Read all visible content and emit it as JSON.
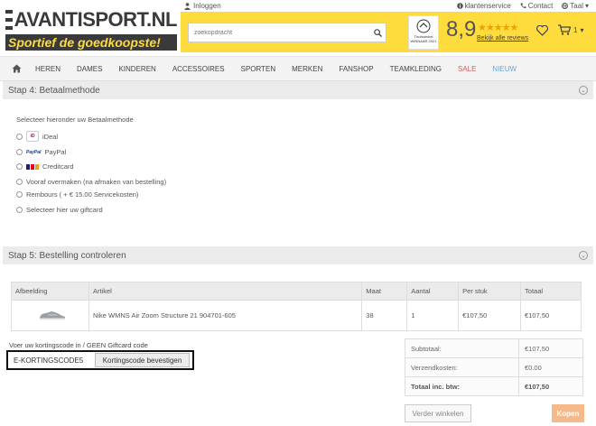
{
  "brand": {
    "name": "AVANTISPORT.NL",
    "tagline": "Sportief de goedkoopste!"
  },
  "topbar": {
    "login_label": "Inloggen",
    "customer_service": "klantenservice",
    "contact": "Contact",
    "language": "Taal"
  },
  "search": {
    "placeholder": "zoekopdracht"
  },
  "rating": {
    "badge_text": "Thuiswinkel WINNAAR 2021",
    "score": "8,9",
    "stars": "★★★★★",
    "reviews_link": "Bekijk alle reviews"
  },
  "cart": {
    "count": "1"
  },
  "nav": {
    "items": [
      "HEREN",
      "DAMES",
      "KINDEREN",
      "ACCESSOIRES",
      "SPORTEN",
      "MERKEN",
      "FANSHOP",
      "TEAMKLEDING",
      "SALE",
      "NIEUW"
    ]
  },
  "step4": {
    "title": "Stap 4: Betaalmethode",
    "intro": "Selecteer hieronder uw Betaalmethode",
    "options": [
      "iDeal",
      "PayPal",
      "Creditcard",
      "Vooraf overmaken (na afmaken van bestelling)",
      "Rembours ( + € 15.00 Servicekosten)",
      "Selecteer hier uw giftcard"
    ],
    "logo_ideal": "iD",
    "logo_paypal": "PayPal"
  },
  "step5": {
    "title": "Stap 5: Bestelling controleren",
    "headers": [
      "Afbeelding",
      "Artikel",
      "Maat",
      "Aantal",
      "Per stuk",
      "Totaal"
    ],
    "rows": [
      {
        "article": "Nike WMNS Air Zoom Structure 21 904701-605",
        "size": "38",
        "qty": "1",
        "unit": "€107,50",
        "total": "€107,50"
      }
    ]
  },
  "discount": {
    "label": "Voer uw kortingscode in / GEEN Giftcard code",
    "value": "E-KORTINGSCODE5",
    "button": "Kortingscode bevestigen"
  },
  "totals": {
    "subtotal_label": "Subtotaal:",
    "subtotal_value": "€107,50",
    "shipping_label": "Verzendkosten:",
    "shipping_value": "€0.00",
    "total_label": "Totaal inc. btw:",
    "total_value": "€107,50"
  },
  "actions": {
    "back": "Verder winkelen",
    "buy": "Kopen"
  },
  "colors": {
    "brand_yellow": "#fedc3d",
    "brand_dark": "#3a3a3a",
    "sale": "#e05a5a",
    "nieuw": "#6aa6d6",
    "buy_button": "#f5b98a"
  }
}
